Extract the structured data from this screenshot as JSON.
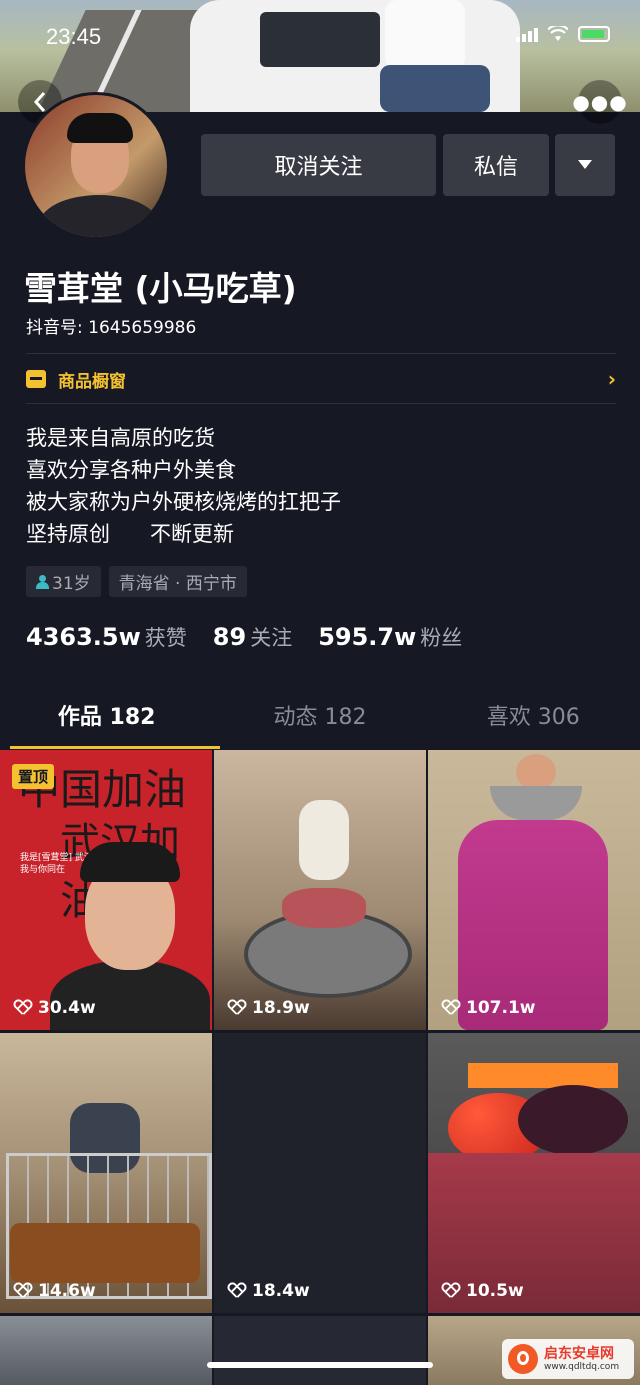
{
  "status_bar": {
    "time": "23:45"
  },
  "profile": {
    "name": "雪茸堂 (小马吃草)",
    "douyin_id": "抖音号: 1645659986",
    "shop_label": "商品橱窗",
    "bio": [
      "我是来自高原的吃货",
      "喜欢分享各种户外美食",
      "被大家称为户外硬核烧烤的扛把子",
      "坚持原创      不断更新"
    ],
    "tags": {
      "age": "31岁",
      "location": "青海省 · 西宁市"
    },
    "stats": {
      "likes_num": "4363.5w",
      "likes_label": "获赞",
      "following_num": "89",
      "following_label": "关注",
      "followers_num": "595.7w",
      "followers_label": "粉丝"
    }
  },
  "actions": {
    "unfollow": "取消关注",
    "message": "私信"
  },
  "tabs": [
    {
      "label": "作品 182"
    },
    {
      "label": "动态 182"
    },
    {
      "label": "喜欢 306"
    }
  ],
  "videos": [
    {
      "likes": "30.4w",
      "pinned": "置顶",
      "title_a": "中国加油",
      "title_b": "武汉加油",
      "caption": "我是[雪茸堂] 武汉我与你同在"
    },
    {
      "likes": "18.9w"
    },
    {
      "likes": "107.1w"
    },
    {
      "likes": "14.6w"
    },
    {
      "likes": "18.4w"
    },
    {
      "likes": "10.5w"
    }
  ],
  "watermark": {
    "name": "启东安卓网",
    "url": "www.qdltdq.com"
  },
  "colors": {
    "background": "#161823",
    "accent": "#f4c130",
    "button": "#393b44"
  }
}
